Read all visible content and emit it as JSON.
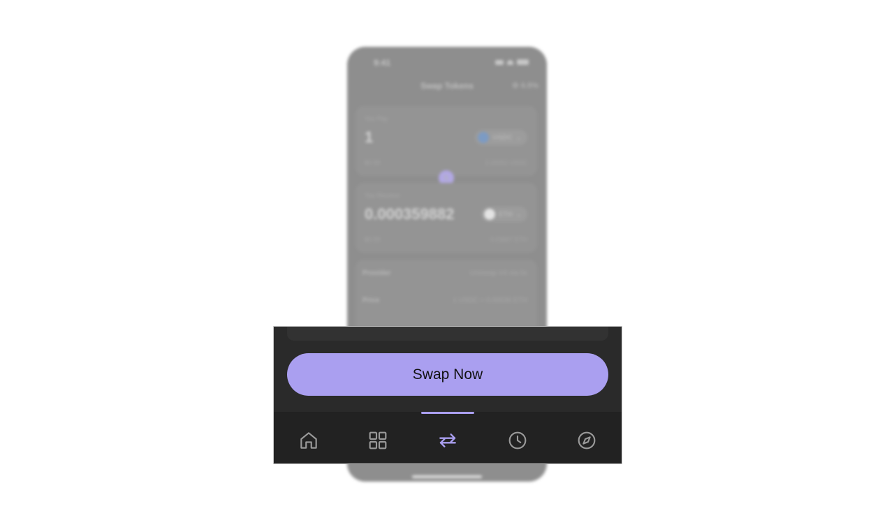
{
  "status_bar": {
    "time": "9:41"
  },
  "header": {
    "title": "Swap Tokens",
    "slippage": "0.5%"
  },
  "pay": {
    "label": "You Pay",
    "amount": "1",
    "token": "USDC",
    "fiat": "$0.99",
    "balance": "2.24052 USDC"
  },
  "receive": {
    "label": "You Receive",
    "amount": "0.000359882",
    "token": "ETH",
    "fiat": "$0.99",
    "balance": "0.03667 ETH"
  },
  "details": {
    "provider_label": "Provider",
    "provider_value": "Uniswap V4 via 0x",
    "price_label": "Price",
    "price_value": "1 USDC ≈ 0.00036 ETH"
  },
  "action": {
    "swap_label": "Swap Now"
  },
  "tabs": [
    {
      "id": "home",
      "icon": "home-icon",
      "active": false
    },
    {
      "id": "apps",
      "icon": "grid-icon",
      "active": false
    },
    {
      "id": "swap",
      "icon": "swap-arrows-icon",
      "active": true
    },
    {
      "id": "history",
      "icon": "clock-icon",
      "active": false
    },
    {
      "id": "explore",
      "icon": "compass-icon",
      "active": false
    }
  ],
  "colors": {
    "accent": "#aa9ff0",
    "tab_icon": "#9a9a9a",
    "tab_bar_bg": "#222222",
    "panel_bg": "#2a2a2a"
  }
}
